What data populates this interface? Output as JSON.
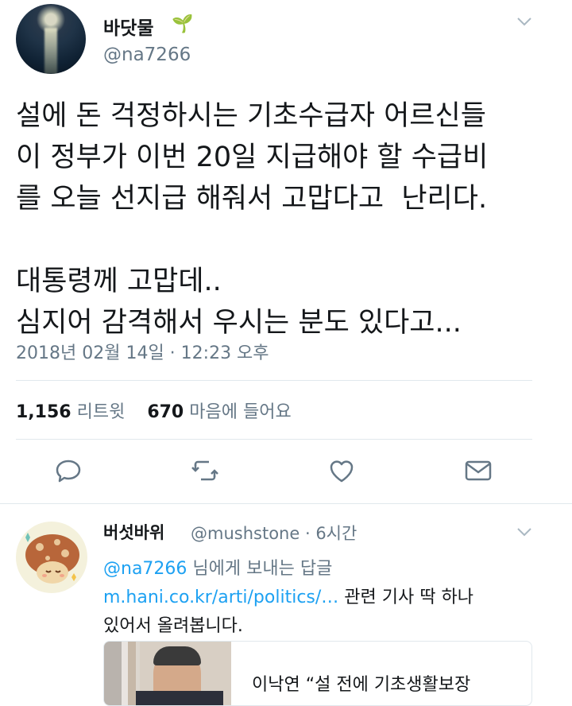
{
  "tweet": {
    "author_name": "바닷물",
    "author_emoji": "🌱",
    "author_handle": "@na7266",
    "text": "설에 돈 걱정하시는 기초수급자 어르신들\n이 정부가 이번 20일 지급해야 할 수급비\n를 오늘 선지급 해줘서 고맙다고  난리다.\n\n대통령께 고맙데..\n심지어 감격해서 우시는 분도 있다고...",
    "timestamp": "2018년 02월 14일 · 12:23 오후",
    "retweet_count": "1,156",
    "retweet_label": "리트윗",
    "like_count": "670",
    "like_label": "마음에 들어요",
    "actions": [
      "reply-icon",
      "retweet-icon",
      "like-icon",
      "dm-icon"
    ]
  },
  "reply": {
    "author_name": "버섯바위",
    "author_handle": "@mushstone",
    "time": "· 6시간",
    "reply_to_handle": "@na7266",
    "reply_to_suffix": " 님에게 보내는 답글",
    "link": "m.hani.co.kr/arti/politics/…",
    "text_after_link": " 관련 기사 딱 하나",
    "text_line2": "있어서 올려봅니다.",
    "card_title": "이낙연 “설 전에 기초생활보장"
  }
}
